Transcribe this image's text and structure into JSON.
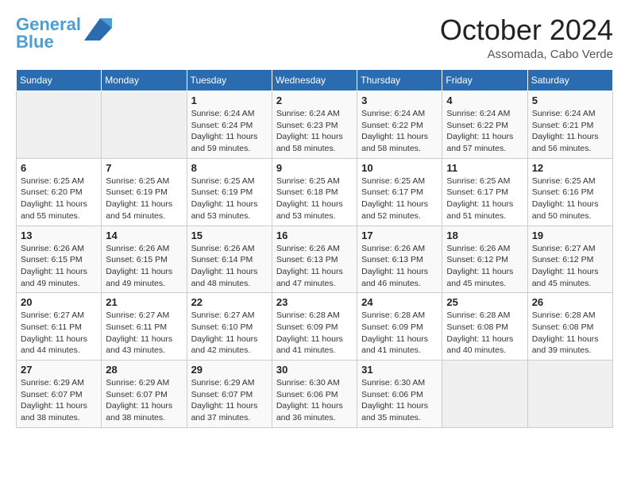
{
  "header": {
    "logo_line1": "General",
    "logo_line2": "Blue",
    "month": "October 2024",
    "location": "Assomada, Cabo Verde"
  },
  "days_of_week": [
    "Sunday",
    "Monday",
    "Tuesday",
    "Wednesday",
    "Thursday",
    "Friday",
    "Saturday"
  ],
  "weeks": [
    [
      {
        "day": "",
        "info": ""
      },
      {
        "day": "",
        "info": ""
      },
      {
        "day": "1",
        "info": "Sunrise: 6:24 AM\nSunset: 6:24 PM\nDaylight: 11 hours and 59 minutes."
      },
      {
        "day": "2",
        "info": "Sunrise: 6:24 AM\nSunset: 6:23 PM\nDaylight: 11 hours and 58 minutes."
      },
      {
        "day": "3",
        "info": "Sunrise: 6:24 AM\nSunset: 6:22 PM\nDaylight: 11 hours and 58 minutes."
      },
      {
        "day": "4",
        "info": "Sunrise: 6:24 AM\nSunset: 6:22 PM\nDaylight: 11 hours and 57 minutes."
      },
      {
        "day": "5",
        "info": "Sunrise: 6:24 AM\nSunset: 6:21 PM\nDaylight: 11 hours and 56 minutes."
      }
    ],
    [
      {
        "day": "6",
        "info": "Sunrise: 6:25 AM\nSunset: 6:20 PM\nDaylight: 11 hours and 55 minutes."
      },
      {
        "day": "7",
        "info": "Sunrise: 6:25 AM\nSunset: 6:19 PM\nDaylight: 11 hours and 54 minutes."
      },
      {
        "day": "8",
        "info": "Sunrise: 6:25 AM\nSunset: 6:19 PM\nDaylight: 11 hours and 53 minutes."
      },
      {
        "day": "9",
        "info": "Sunrise: 6:25 AM\nSunset: 6:18 PM\nDaylight: 11 hours and 53 minutes."
      },
      {
        "day": "10",
        "info": "Sunrise: 6:25 AM\nSunset: 6:17 PM\nDaylight: 11 hours and 52 minutes."
      },
      {
        "day": "11",
        "info": "Sunrise: 6:25 AM\nSunset: 6:17 PM\nDaylight: 11 hours and 51 minutes."
      },
      {
        "day": "12",
        "info": "Sunrise: 6:25 AM\nSunset: 6:16 PM\nDaylight: 11 hours and 50 minutes."
      }
    ],
    [
      {
        "day": "13",
        "info": "Sunrise: 6:26 AM\nSunset: 6:15 PM\nDaylight: 11 hours and 49 minutes."
      },
      {
        "day": "14",
        "info": "Sunrise: 6:26 AM\nSunset: 6:15 PM\nDaylight: 11 hours and 49 minutes."
      },
      {
        "day": "15",
        "info": "Sunrise: 6:26 AM\nSunset: 6:14 PM\nDaylight: 11 hours and 48 minutes."
      },
      {
        "day": "16",
        "info": "Sunrise: 6:26 AM\nSunset: 6:13 PM\nDaylight: 11 hours and 47 minutes."
      },
      {
        "day": "17",
        "info": "Sunrise: 6:26 AM\nSunset: 6:13 PM\nDaylight: 11 hours and 46 minutes."
      },
      {
        "day": "18",
        "info": "Sunrise: 6:26 AM\nSunset: 6:12 PM\nDaylight: 11 hours and 45 minutes."
      },
      {
        "day": "19",
        "info": "Sunrise: 6:27 AM\nSunset: 6:12 PM\nDaylight: 11 hours and 45 minutes."
      }
    ],
    [
      {
        "day": "20",
        "info": "Sunrise: 6:27 AM\nSunset: 6:11 PM\nDaylight: 11 hours and 44 minutes."
      },
      {
        "day": "21",
        "info": "Sunrise: 6:27 AM\nSunset: 6:11 PM\nDaylight: 11 hours and 43 minutes."
      },
      {
        "day": "22",
        "info": "Sunrise: 6:27 AM\nSunset: 6:10 PM\nDaylight: 11 hours and 42 minutes."
      },
      {
        "day": "23",
        "info": "Sunrise: 6:28 AM\nSunset: 6:09 PM\nDaylight: 11 hours and 41 minutes."
      },
      {
        "day": "24",
        "info": "Sunrise: 6:28 AM\nSunset: 6:09 PM\nDaylight: 11 hours and 41 minutes."
      },
      {
        "day": "25",
        "info": "Sunrise: 6:28 AM\nSunset: 6:08 PM\nDaylight: 11 hours and 40 minutes."
      },
      {
        "day": "26",
        "info": "Sunrise: 6:28 AM\nSunset: 6:08 PM\nDaylight: 11 hours and 39 minutes."
      }
    ],
    [
      {
        "day": "27",
        "info": "Sunrise: 6:29 AM\nSunset: 6:07 PM\nDaylight: 11 hours and 38 minutes."
      },
      {
        "day": "28",
        "info": "Sunrise: 6:29 AM\nSunset: 6:07 PM\nDaylight: 11 hours and 38 minutes."
      },
      {
        "day": "29",
        "info": "Sunrise: 6:29 AM\nSunset: 6:07 PM\nDaylight: 11 hours and 37 minutes."
      },
      {
        "day": "30",
        "info": "Sunrise: 6:30 AM\nSunset: 6:06 PM\nDaylight: 11 hours and 36 minutes."
      },
      {
        "day": "31",
        "info": "Sunrise: 6:30 AM\nSunset: 6:06 PM\nDaylight: 11 hours and 35 minutes."
      },
      {
        "day": "",
        "info": ""
      },
      {
        "day": "",
        "info": ""
      }
    ]
  ]
}
